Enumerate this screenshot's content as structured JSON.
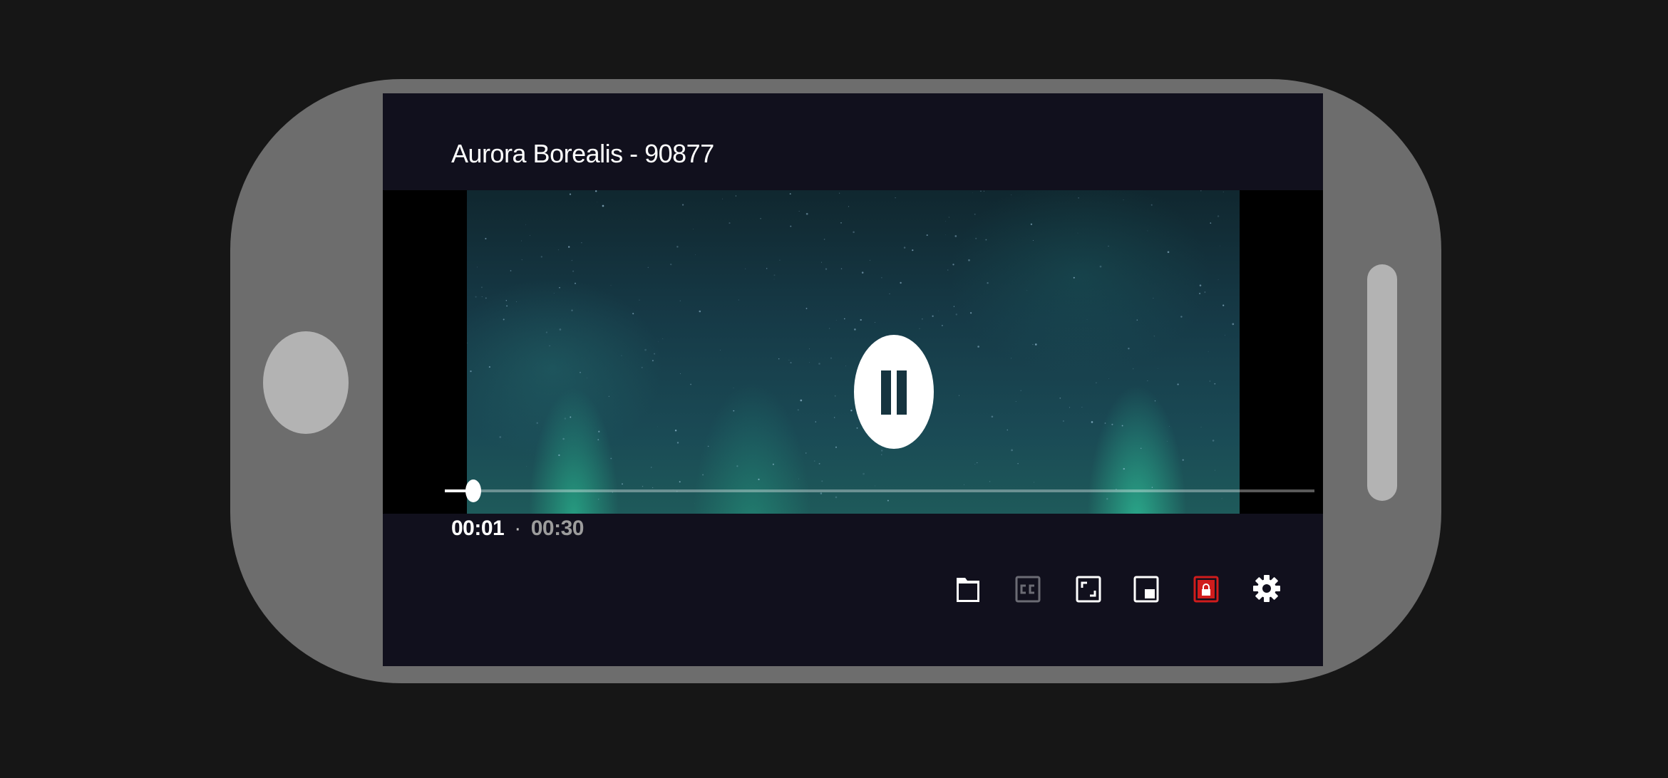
{
  "video": {
    "title": "Aurora Borealis - 90877"
  },
  "playback": {
    "state": "playing",
    "current_time": "00:01",
    "separator": "·",
    "total_time": "00:30",
    "progress_fraction": 0.033
  },
  "controls": [
    {
      "name": "folder-icon",
      "enabled": true
    },
    {
      "name": "closed-captions-icon",
      "enabled": false
    },
    {
      "name": "fullscreen-icon",
      "enabled": true
    },
    {
      "name": "picture-in-picture-icon",
      "enabled": true
    },
    {
      "name": "lock-icon",
      "enabled": true,
      "active": true
    }
  ],
  "settings": {
    "name": "gear-icon"
  },
  "colors": {
    "screen_background": "#11101d",
    "phone_body": "#6d6d6d",
    "lock_active": "#d01c1c",
    "disabled_icon": "#6b6b74",
    "icon": "#ffffff"
  }
}
